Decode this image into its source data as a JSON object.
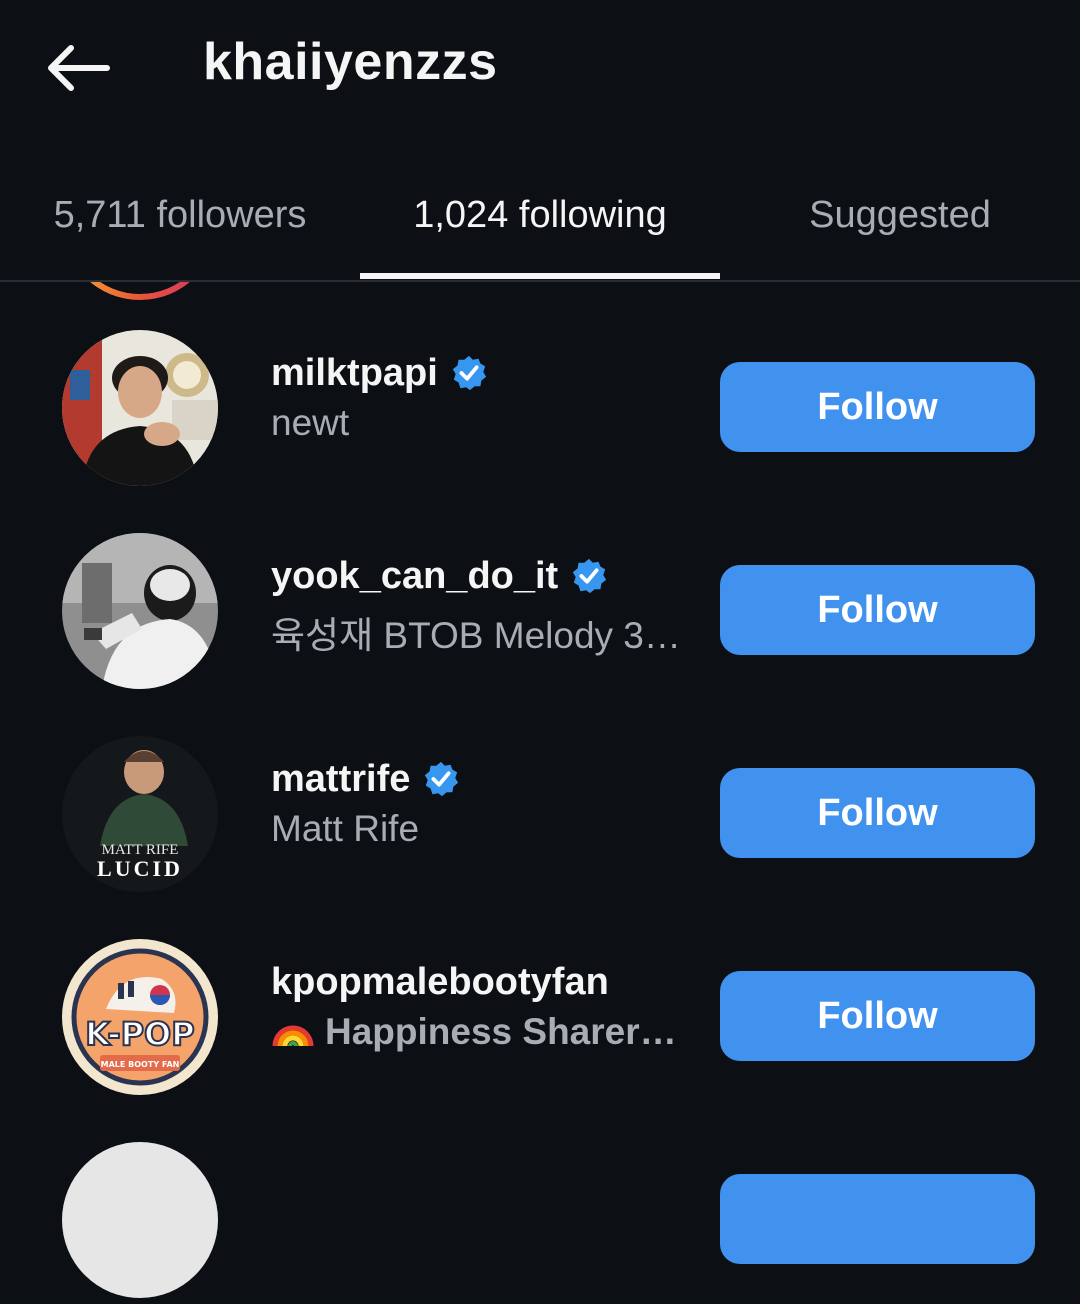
{
  "header": {
    "title": "khaiiyenzzs",
    "back_icon": "arrow-left-icon"
  },
  "tabs": [
    {
      "label": "5,711 followers",
      "active": false
    },
    {
      "label": "1,024 following",
      "active": true
    },
    {
      "label": "Suggested",
      "active": false
    }
  ],
  "colors": {
    "background": "#0c1014",
    "follow_button": "#4192ef",
    "verified_badge": "#3797f0",
    "secondary_text": "#a8adb3"
  },
  "accounts": [
    {
      "username": "milktpapi",
      "verified": true,
      "subtitle": "newt",
      "button_label": "Follow"
    },
    {
      "username": "yook_can_do_it",
      "verified": true,
      "subtitle": "육성재 BTOB Melody 3…",
      "button_label": "Follow"
    },
    {
      "username": "mattrife",
      "verified": true,
      "subtitle": "Matt Rife",
      "button_label": "Follow",
      "avatar_text": {
        "line1": "MATT RIFE",
        "line2": "LUCID"
      }
    },
    {
      "username": "kpopmalebootyfan",
      "verified": false,
      "subtitle": "Happiness Sharer…",
      "subtitle_emoji": "rainbow-emoji",
      "button_label": "Follow",
      "avatar_text": {
        "line1": "K-POP",
        "line2": "MALE BOOTY FAN"
      }
    }
  ]
}
